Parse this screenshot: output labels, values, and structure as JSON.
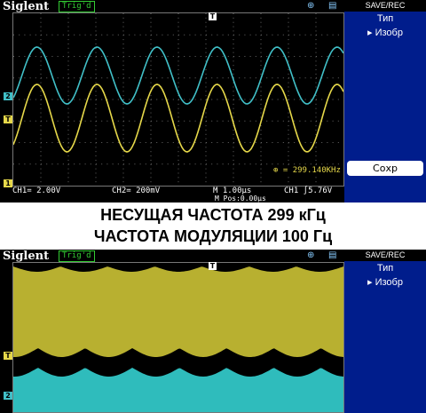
{
  "captions": {
    "line1": "НЕСУЩАЯ ЧАСТОТА 299 кГц",
    "line2": "ЧАСТОТА МОДУЛЯЦИИ 100 Гц"
  },
  "scope_top": {
    "brand": "Siglent",
    "trigger_status": "Trig'd",
    "menu_title": "SAVE/REC",
    "menu_items": [
      "Тип",
      "Изобр"
    ],
    "save_button": "Сохр",
    "frequency_readout": "299.140KHz",
    "ch1_scale": "CH1= 2.00V",
    "ch2_scale": "CH2= 200mV",
    "timebase": "M 1.00μs",
    "mpos": "M Pos:0.00μs",
    "trigger_level": "CH1 ∫5.76V",
    "channel_markers": [
      "2",
      "1"
    ],
    "trigger_marker": "T",
    "colors": {
      "ch1": "#e6d84a",
      "ch2": "#41c0c8",
      "menu_bg": "#001d8c"
    },
    "chart_data": {
      "type": "line",
      "series": [
        {
          "color": "#e6d84a",
          "shape": "sine",
          "cycles": 5.5
        },
        {
          "color": "#41c0c8",
          "shape": "sine",
          "cycles": 5.5
        }
      ]
    }
  },
  "scope_bottom": {
    "brand": "Siglent",
    "trigger_status": "Trig'd",
    "menu_title": "SAVE/REC",
    "menu_items": [
      "Тип",
      "Изобр"
    ],
    "channel_markers": [
      "2"
    ],
    "trigger_marker": "T",
    "colors": {
      "ch1": "#b8b030",
      "ch2": "#2fbcbc",
      "menu_bg": "#001d8c"
    }
  }
}
